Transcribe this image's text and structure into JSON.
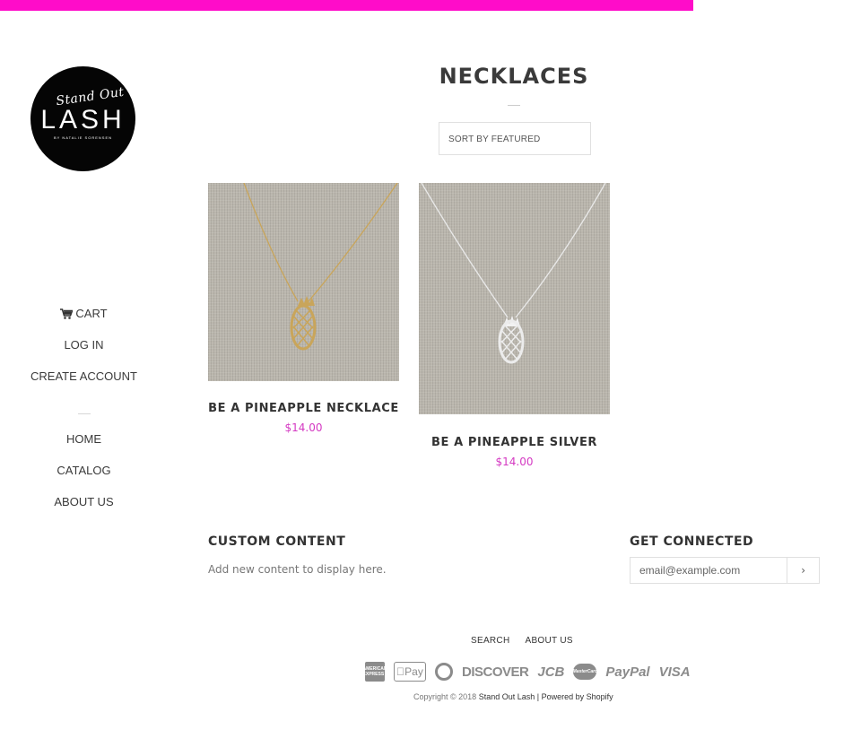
{
  "brand": {
    "script": "Stand Out",
    "name": "LASH",
    "byline": "BY NATALIE SORENSEN"
  },
  "accent_color": "#ff0cc9",
  "sidebar": {
    "cart": "CART",
    "login": "LOG IN",
    "create_account": "CREATE ACCOUNT",
    "home": "HOME",
    "catalog": "CATALOG",
    "about": "ABOUT US"
  },
  "collection": {
    "title": "NECKLACES",
    "sort_label": "SORT BY FEATURED"
  },
  "products": [
    {
      "name": "BE A PINEAPPLE NECKLACE",
      "price": "$14.00",
      "metal_color": "#c9a55a"
    },
    {
      "name": "BE A PINEAPPLE SILVER",
      "price": "$14.00",
      "metal_color": "#e4e4e4"
    }
  ],
  "footer": {
    "custom_heading": "CUSTOM CONTENT",
    "custom_text": "Add new content to display here.",
    "connect_heading": "GET CONNECTED",
    "email_placeholder": "email@example.com",
    "links": [
      "SEARCH",
      "ABOUT US"
    ],
    "payment_icons": [
      "american-express-icon",
      "apple-pay-icon",
      "diners-club-icon",
      "discover-icon",
      "jcb-icon",
      "mastercard-icon",
      "paypal-icon",
      "visa-icon"
    ],
    "payments": {
      "amex": "AMERICAN EXPRESS",
      "applepay": "Pay",
      "discover": "DISCOVER",
      "jcb": "JCB",
      "mastercard": "MasterCard",
      "paypal": "PayPal",
      "visa": "VISA"
    },
    "copyright_prefix": "Copyright © 2018",
    "store_name": "Stand Out Lash",
    "powered": "| Powered by Shopify"
  }
}
